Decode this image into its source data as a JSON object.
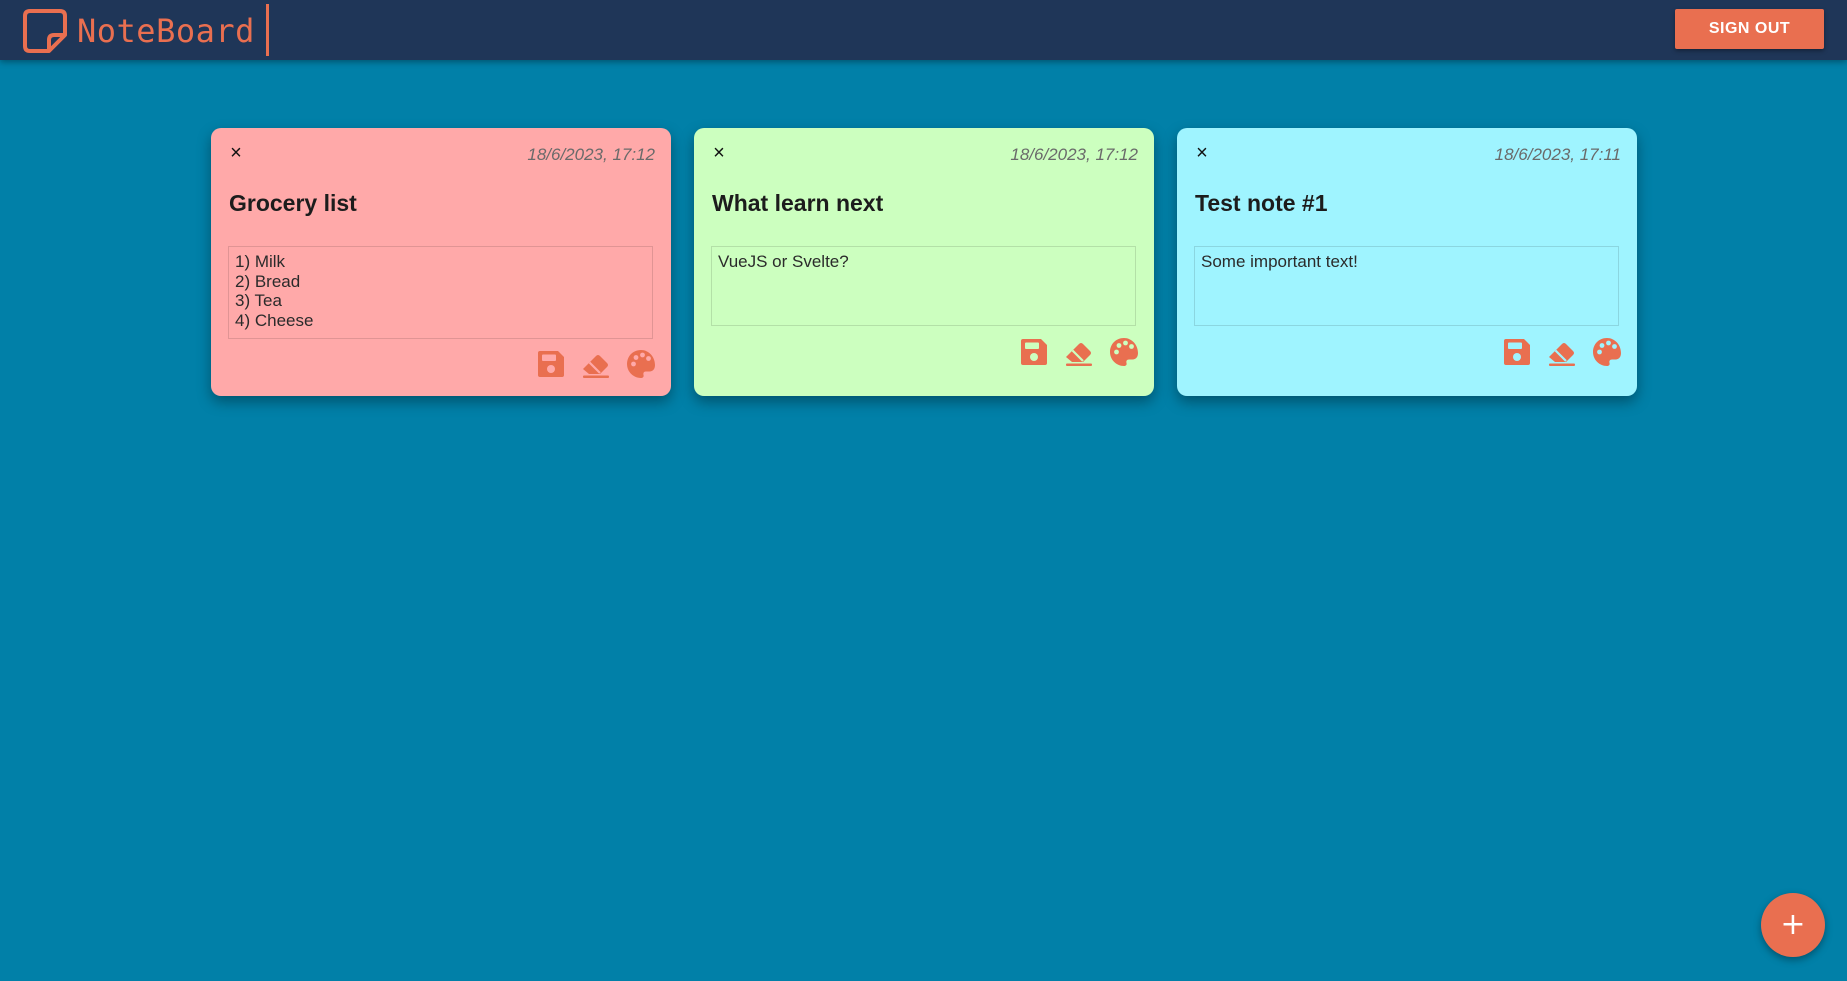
{
  "app": {
    "name": "NoteBoard",
    "logo_icon": "sticky-note-icon",
    "sign_out_label": "SIGN OUT",
    "add_note_label": "+"
  },
  "colors": {
    "background": "#0180a8",
    "topbar": "#1f3658",
    "accent": "#e96f50"
  },
  "notes": [
    {
      "color": "#ffa9a9",
      "close_label": "×",
      "date": "18/6/2023, 17:12",
      "title": "Grocery list",
      "body": "1) Milk\n2) Bread\n3) Tea\n4) Cheese",
      "actions": [
        "save-icon",
        "eraser-icon",
        "palette-icon"
      ]
    },
    {
      "color": "#ccffbf",
      "close_label": "×",
      "date": "18/6/2023, 17:12",
      "title": "What learn next",
      "body": "VueJS or Svelte?",
      "actions": [
        "save-icon",
        "eraser-icon",
        "palette-icon"
      ]
    },
    {
      "color": "#9ff4ff",
      "close_label": "×",
      "date": "18/6/2023, 17:11",
      "title": "Test note #1",
      "body": "Some important text!",
      "actions": [
        "save-icon",
        "eraser-icon",
        "palette-icon"
      ]
    }
  ]
}
